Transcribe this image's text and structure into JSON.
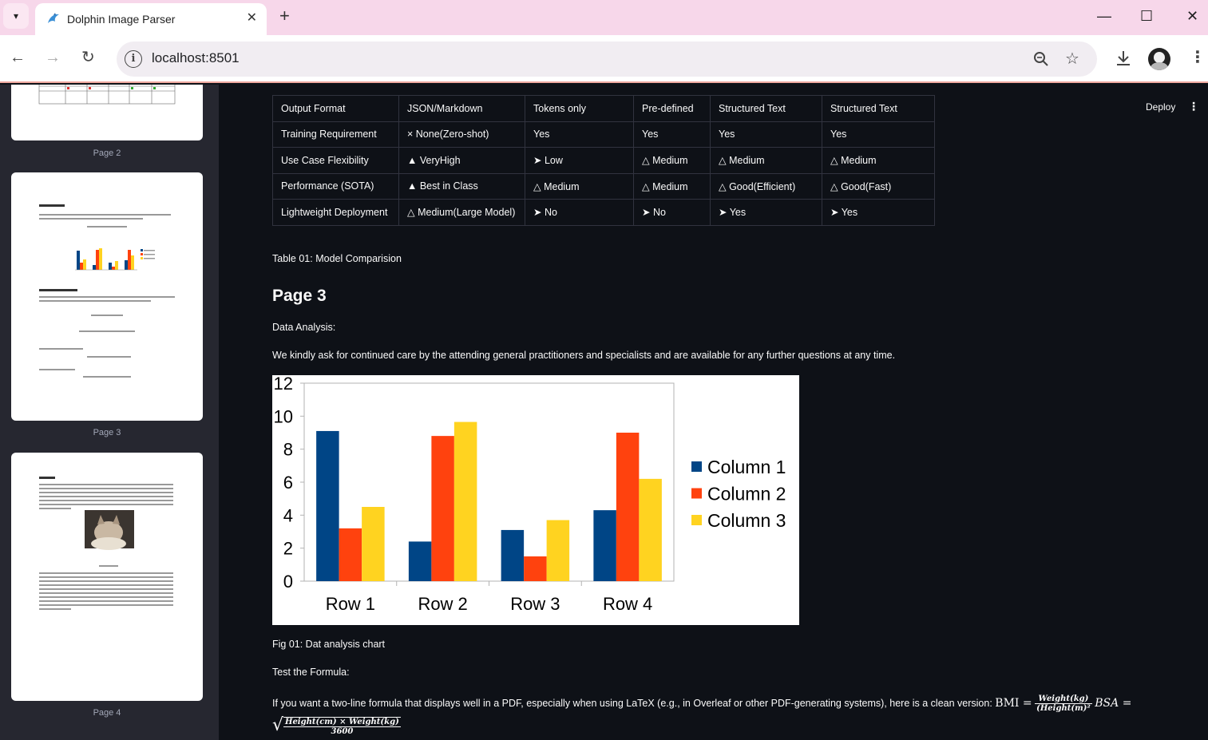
{
  "browser": {
    "tab_title": "Dolphin Image Parser",
    "url": "localhost:8501"
  },
  "sidebar": {
    "pages": [
      {
        "caption": "Page 2"
      },
      {
        "caption": "Page 3"
      },
      {
        "caption": "Page 4"
      }
    ]
  },
  "header": {
    "deploy_label": "Deploy"
  },
  "table": {
    "rows": [
      [
        "Output Format",
        "JSON/Markdown",
        "Tokens only",
        "Pre-defined",
        "Structured Text",
        "Structured Text"
      ],
      [
        "Training Requirement",
        "× None(Zero-shot)",
        "Yes",
        "Yes",
        "Yes",
        "Yes"
      ],
      [
        "Use Case Flexibility",
        "▲ VeryHigh",
        "➤ Low",
        "△ Medium",
        "△ Medium",
        "△ Medium"
      ],
      [
        "Performance (SOTA)",
        "▲ Best in Class",
        "△ Medium",
        "△ Medium",
        "△ Good(Efficient)",
        "△ Good(Fast)"
      ],
      [
        "Lightweight Deployment",
        "△ Medium(Large Model)",
        "➤ No",
        "➤ No",
        "➤ Yes",
        "➤ Yes"
      ]
    ],
    "caption": "Table 01: Model Comparision"
  },
  "content": {
    "heading": "Page 3",
    "data_analysis": "Data Analysis:",
    "paragraph": "We kindly ask for continued care by the attending general practitioners and specialists and are available for any further questions at any time.",
    "fig_caption": "Fig 01: Dat analysis chart",
    "test_formula": "Test the Formula:",
    "formula_intro": "If you want a two-line formula that displays well in a PDF, especially when using LaTeX (e.g., in Overleaf or other PDF-generating systems), here is a clean version:",
    "bmi_label": "BMI =",
    "bmi_num": "Weight(kg)",
    "bmi_den": "(Height(m)²",
    "bsa_label": "BSA =",
    "bsa_num": "Height(cm) × Weight(kg)",
    "bsa_den": "3600"
  },
  "chart_data": {
    "type": "bar",
    "categories": [
      "Row 1",
      "Row 2",
      "Row 3",
      "Row 4"
    ],
    "series": [
      {
        "name": "Column 1",
        "values": [
          9.1,
          2.4,
          3.1,
          4.3
        ],
        "color": "#004586"
      },
      {
        "name": "Column 2",
        "values": [
          3.2,
          8.8,
          1.5,
          9.0
        ],
        "color": "#ff420e"
      },
      {
        "name": "Column 3",
        "values": [
          4.5,
          9.65,
          3.7,
          6.2
        ],
        "color": "#ffd320"
      }
    ],
    "ylim": [
      0,
      12
    ],
    "yticks": [
      0,
      2,
      4,
      6,
      8,
      10,
      12
    ],
    "legend": "right",
    "grid": false
  }
}
